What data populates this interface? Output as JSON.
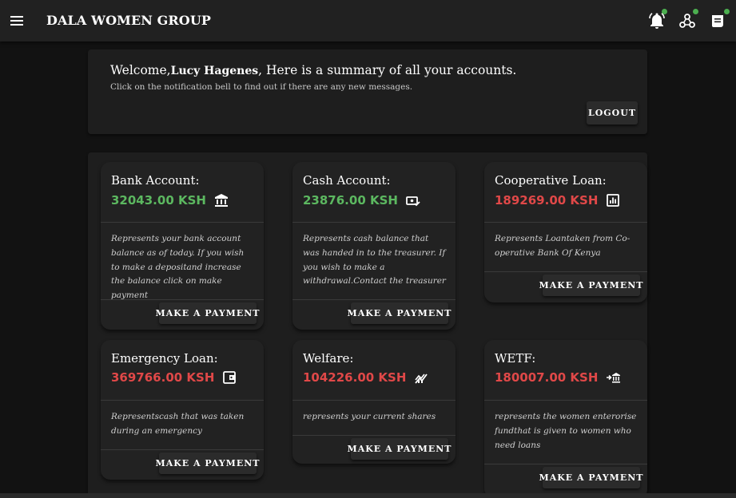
{
  "header": {
    "title": "DALA WOMEN GROUP",
    "icons": [
      "menu-icon",
      "notification-bell-icon",
      "hub-icon",
      "receipt-icon"
    ],
    "badge_color": "#4caf50"
  },
  "welcome": {
    "prefix": "Welcome,",
    "name": "Lucy Hagenes",
    "suffix": ", Here is a summary of all your accounts.",
    "subtitle": "Click on the notification bell to find out if there are any new messages.",
    "logout_label": "LOGOUT"
  },
  "accounts": [
    {
      "title": "Bank Account:",
      "amount": "32043.00 KSH",
      "status": "positive",
      "icon": "bank-icon",
      "description": "Represents your bank account balance as of today. If you wish to make a depositand increase the balance click on make payment",
      "button": "MAKE A PAYMENT"
    },
    {
      "title": "Cash Account:",
      "amount": "23876.00 KSH",
      "status": "positive",
      "icon": "cash-check-icon",
      "description": "Represents cash balance that was handed in to the treasurer. If you wish to make a withdrawal.Contact the treasurer",
      "button": "MAKE A PAYMENT"
    },
    {
      "title": "Cooperative Loan:",
      "amount": "189269.00 KSH",
      "status": "negative",
      "icon": "chart-icon",
      "description": "Represents Loantaken from Co-operative Bank Of Kenya",
      "button": "MAKE A PAYMENT"
    },
    {
      "title": "Emergency Loan:",
      "amount": "369766.00 KSH",
      "status": "negative",
      "icon": "wallet-icon",
      "description": "Representscash that was taken during an emergency",
      "button": "MAKE A PAYMENT"
    },
    {
      "title": "Welfare:",
      "amount": "104226.00 KSH",
      "status": "negative",
      "icon": "stacked-chart-icon",
      "description": "represents your current shares",
      "button": "MAKE A PAYMENT"
    },
    {
      "title": "WETF:",
      "amount": "180007.00 KSH",
      "status": "negative",
      "icon": "bank-transfer-icon",
      "description": "represents the women enterorise fundthat is given to women who need loans",
      "button": "MAKE A PAYMENT"
    }
  ],
  "colors": {
    "positive": "#5cb860",
    "negative": "#e04848",
    "background": "#121212",
    "surface": "#1e1e1e"
  }
}
